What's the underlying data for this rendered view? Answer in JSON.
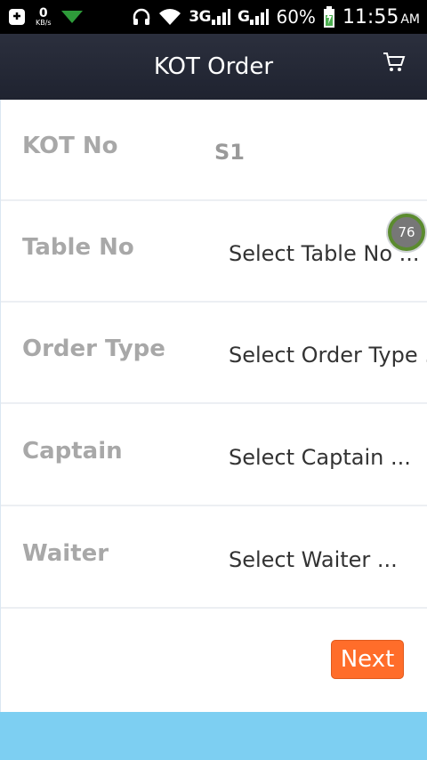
{
  "status_bar": {
    "kbs_value": "0",
    "kbs_unit": "KB/s",
    "network_3g": "3G",
    "network_g": "G",
    "battery_percent": "60%",
    "time": "11:55",
    "ampm": "AM"
  },
  "header": {
    "title": "KOT Order",
    "cart_icon": "cart-icon"
  },
  "form": {
    "rows": [
      {
        "label": "KOT No",
        "value": "S1"
      },
      {
        "label": "Table No",
        "value": "Select Table No ..."
      },
      {
        "label": "Order Type",
        "value": "Select Order Type ..."
      },
      {
        "label": "Captain",
        "value": "Select Captain ..."
      },
      {
        "label": "Waiter",
        "value": "Select Waiter ..."
      }
    ],
    "next_label": "Next"
  },
  "badge": {
    "value": "76"
  },
  "colors": {
    "header_bg": "#2b2f3d",
    "accent": "#ff6d2a",
    "bottom_bar": "#7dcff2"
  }
}
